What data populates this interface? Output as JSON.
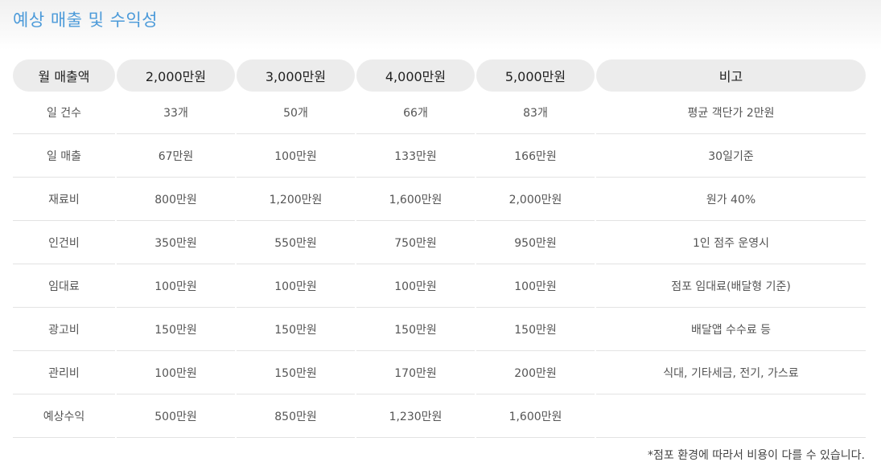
{
  "title": "예상 매출 및 수익성",
  "table": {
    "headers": [
      "월 매출액",
      "2,000만원",
      "3,000만원",
      "4,000만원",
      "5,000만원",
      "비고"
    ],
    "rows": [
      [
        "일 건수",
        "33개",
        "50개",
        "66개",
        "83개",
        "평균 객단가 2만원"
      ],
      [
        "일 매출",
        "67만원",
        "100만원",
        "133만원",
        "166만원",
        "30일기준"
      ],
      [
        "재료비",
        "800만원",
        "1,200만원",
        "1,600만원",
        "2,000만원",
        "원가 40%"
      ],
      [
        "인건비",
        "350만원",
        "550만원",
        "750만원",
        "950만원",
        "1인 점주 운영시"
      ],
      [
        "임대료",
        "100만원",
        "100만원",
        "100만원",
        "100만원",
        "점포 임대료(배달형 기준)"
      ],
      [
        "광고비",
        "150만원",
        "150만원",
        "150만원",
        "150만원",
        "배달앱 수수료 등"
      ],
      [
        "관리비",
        "100만원",
        "150만원",
        "170만원",
        "200만원",
        "식대, 기타세금, 전기, 가스료"
      ],
      [
        "예상수익",
        "500만원",
        "850만원",
        "1,230만원",
        "1,600만원",
        ""
      ]
    ]
  },
  "footnote": "*점포 환경에 따라서 비용이 다를 수 있습니다.",
  "colors": {
    "title": "#4b9ad9",
    "header_bg": "#ececec",
    "row_divider": "#e3e3e3"
  }
}
